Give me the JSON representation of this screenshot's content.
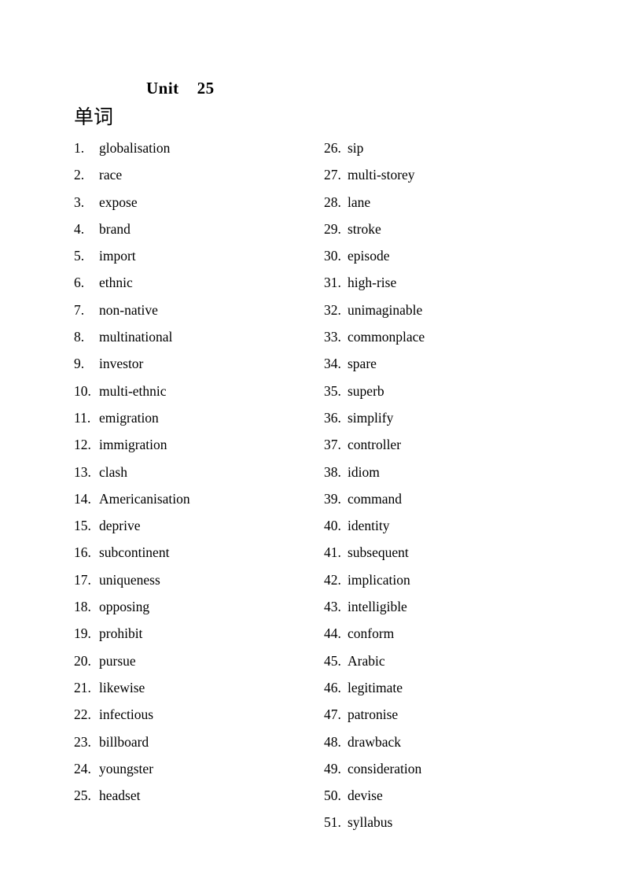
{
  "document": {
    "title": "Unit    25",
    "section_heading": "单词",
    "background_color": "#ffffff",
    "text_color": "#000000"
  },
  "word_list": {
    "left_column": [
      {
        "number": "1.",
        "word": "globalisation"
      },
      {
        "number": "2.",
        "word": "race"
      },
      {
        "number": "3.",
        "word": "expose"
      },
      {
        "number": "4.",
        "word": "brand"
      },
      {
        "number": "5.",
        "word": "import"
      },
      {
        "number": "6.",
        "word": "ethnic"
      },
      {
        "number": "7.",
        "word": "non-native"
      },
      {
        "number": "8.",
        "word": "multinational"
      },
      {
        "number": "9.",
        "word": "investor"
      },
      {
        "number": "10.",
        "word": "multi-ethnic"
      },
      {
        "number": "11.",
        "word": "emigration"
      },
      {
        "number": "12.",
        "word": "immigration"
      },
      {
        "number": "13.",
        "word": "clash"
      },
      {
        "number": "14.",
        "word": "Americanisation"
      },
      {
        "number": "15.",
        "word": "deprive"
      },
      {
        "number": "16.",
        "word": "subcontinent"
      },
      {
        "number": "17.",
        "word": "uniqueness"
      },
      {
        "number": "18.",
        "word": "opposing"
      },
      {
        "number": "19.",
        "word": "prohibit"
      },
      {
        "number": "20.",
        "word": "pursue"
      },
      {
        "number": "21.",
        "word": "likewise"
      },
      {
        "number": "22.",
        "word": "infectious"
      },
      {
        "number": "23.",
        "word": "billboard"
      },
      {
        "number": "24.",
        "word": "youngster"
      },
      {
        "number": "25.",
        "word": "headset"
      }
    ],
    "right_column": [
      {
        "number": "26.",
        "word": "sip"
      },
      {
        "number": "27.",
        "word": "multi-storey"
      },
      {
        "number": "28.",
        "word": "lane"
      },
      {
        "number": "29.",
        "word": "stroke"
      },
      {
        "number": "30.",
        "word": "episode"
      },
      {
        "number": "31.",
        "word": "high-rise"
      },
      {
        "number": "32.",
        "word": "unimaginable"
      },
      {
        "number": "33.",
        "word": "commonplace"
      },
      {
        "number": "34.",
        "word": "spare"
      },
      {
        "number": "35.",
        "word": "superb"
      },
      {
        "number": "36.",
        "word": "simplify"
      },
      {
        "number": "37.",
        "word": "controller"
      },
      {
        "number": "38.",
        "word": "idiom"
      },
      {
        "number": "39.",
        "word": "command"
      },
      {
        "number": "40.",
        "word": "identity"
      },
      {
        "number": "41.",
        "word": "subsequent"
      },
      {
        "number": "42.",
        "word": "implication"
      },
      {
        "number": "43.",
        "word": "intelligible"
      },
      {
        "number": "44.",
        "word": "conform"
      },
      {
        "number": "45.",
        "word": "Arabic"
      },
      {
        "number": "46.",
        "word": "legitimate"
      },
      {
        "number": "47.",
        "word": "patronise"
      },
      {
        "number": "48.",
        "word": "drawback"
      },
      {
        "number": "49.",
        "word": "consideration"
      },
      {
        "number": "50.",
        "word": "devise"
      },
      {
        "number": "51.",
        "word": "syllabus"
      }
    ]
  }
}
